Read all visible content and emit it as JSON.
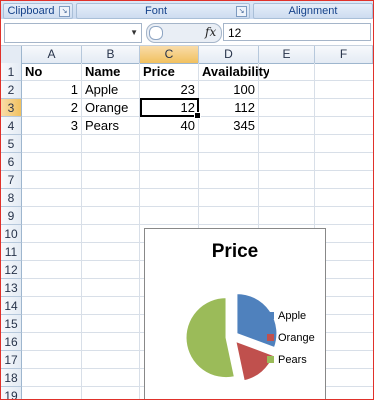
{
  "ribbon": {
    "groups": [
      {
        "label": "Clipboard",
        "launcher": "dialog-launcher-icon"
      },
      {
        "label": "Font",
        "launcher": "dialog-launcher-icon"
      },
      {
        "label": "Alignment"
      }
    ]
  },
  "formula_bar": {
    "name_box": "",
    "fx_label": "fx",
    "value": "12"
  },
  "sheet": {
    "columns": [
      "A",
      "B",
      "C",
      "D",
      "E",
      "F"
    ],
    "selected_column": "C",
    "rows": [
      "1",
      "2",
      "3",
      "4",
      "5",
      "6",
      "7",
      "8",
      "9",
      "10",
      "11",
      "12",
      "13",
      "14",
      "15",
      "16",
      "17",
      "18",
      "19"
    ],
    "selected_row": "3",
    "headers": {
      "A1": "No",
      "B1": "Name",
      "C1": "Price",
      "D1": "Availability"
    },
    "data": [
      {
        "no": "1",
        "name": "Apple",
        "price": "23",
        "availability": "100"
      },
      {
        "no": "2",
        "name": "Orange",
        "price": "12",
        "availability": "112"
      },
      {
        "no": "3",
        "name": "Pears",
        "price": "40",
        "availability": "345"
      }
    ],
    "active_cell": "C3"
  },
  "chart_data": {
    "type": "pie",
    "title": "Price",
    "categories": [
      "Apple",
      "Orange",
      "Pears"
    ],
    "values": [
      23,
      12,
      40
    ],
    "colors": [
      "#4f81bd",
      "#c0504d",
      "#9bbb59"
    ],
    "exploded": true,
    "legend": "right"
  }
}
